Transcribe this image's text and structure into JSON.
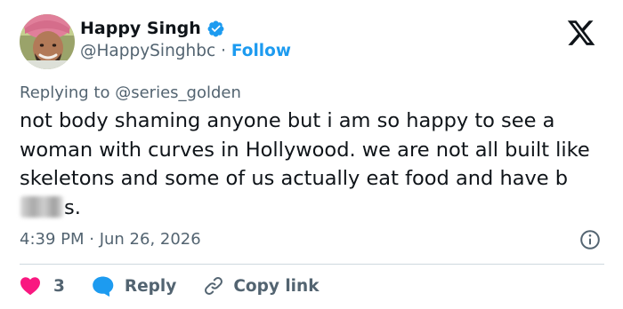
{
  "author": {
    "display_name": "Happy Singh",
    "handle": "@HappySinghbc",
    "separator": "·",
    "follow_label": "Follow",
    "verified": true
  },
  "brand": {
    "logo_icon": "x-logo-icon"
  },
  "reply_context": {
    "prefix": "Replying to",
    "mention": "@series_golden"
  },
  "tweet": {
    "text_before_redaction": "not body shaming anyone but i am so happy to see a woman with curves in Hollywood. we are not all built like skeletons and some of us actually eat food and have b",
    "text_after_redaction": "s.",
    "timestamp": "4:39 PM · Jun 26, 2026"
  },
  "actions": {
    "like_count": "3",
    "reply_label": "Reply",
    "copy_link_label": "Copy link"
  },
  "colors": {
    "accent": "#1d9bf0",
    "like": "#f91880",
    "muted": "#536471",
    "text": "#0f1419",
    "divider": "#cfd9de"
  }
}
